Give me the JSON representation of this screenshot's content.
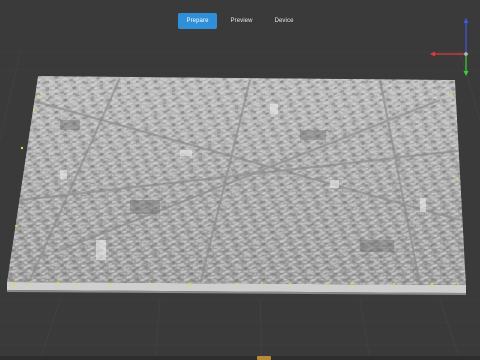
{
  "toolbar": {
    "tabs": [
      {
        "label": "Prepare",
        "active": true
      },
      {
        "label": "Preview",
        "active": false
      },
      {
        "label": "Device",
        "active": false
      }
    ]
  },
  "viewport": {
    "background_color": "#3a3a3a",
    "grid_color": "#454545",
    "model_color": "#a8a8a8",
    "base_color": "#cfcfcf",
    "support_marker_color": "#e6d83a"
  },
  "axis_gizmo": {
    "x_color": "#e23a3a",
    "y_color": "#3ad03a",
    "z_color": "#3a5ae2"
  },
  "accent_color": "#2f8fd8"
}
